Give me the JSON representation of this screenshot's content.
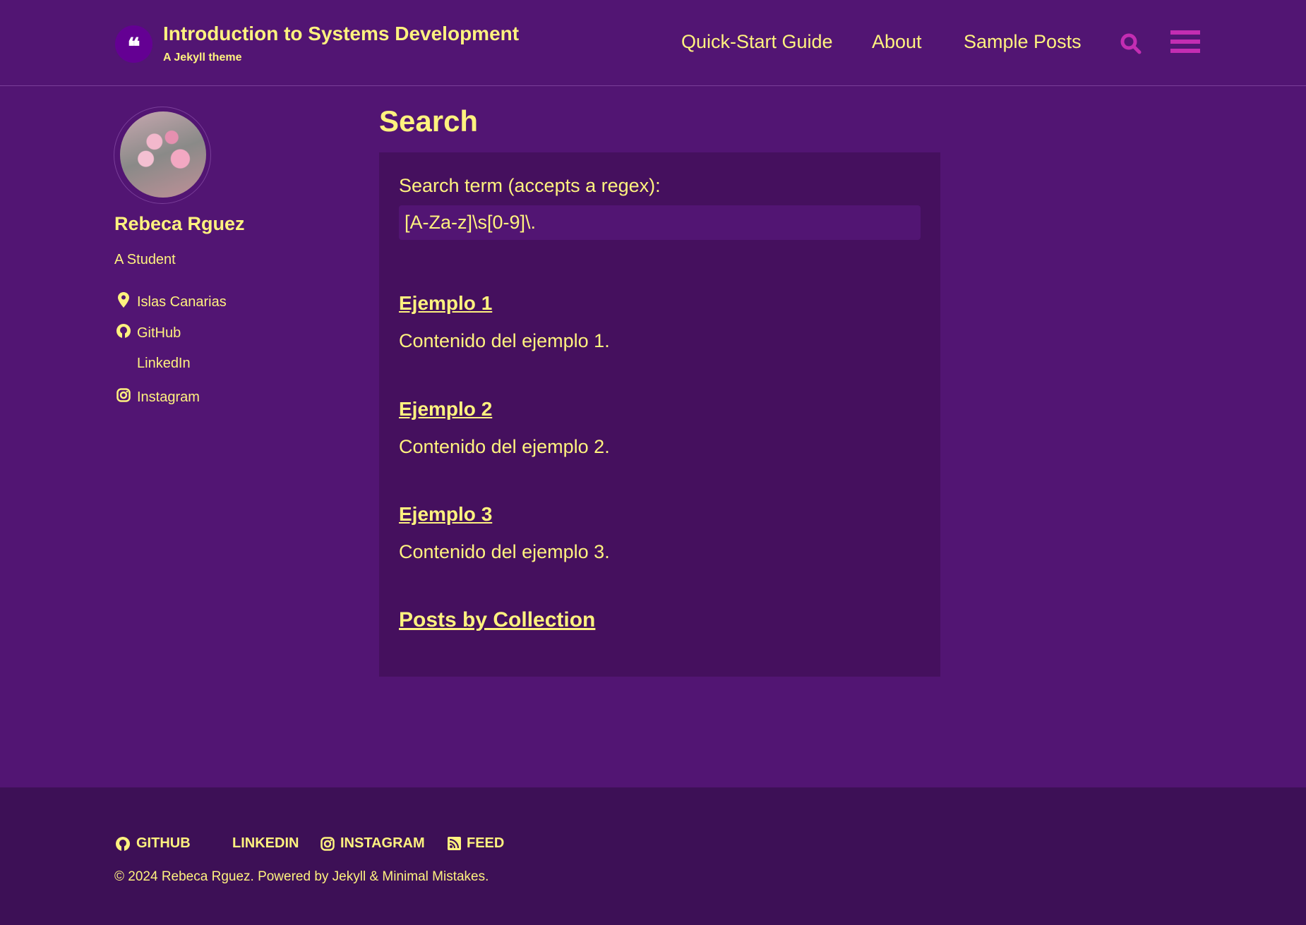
{
  "header": {
    "logo_glyph": "❝",
    "site_title": "Introduction to Systems Development",
    "site_subtitle": "A Jekyll theme",
    "nav": [
      {
        "label": "Quick-Start Guide"
      },
      {
        "label": "About"
      },
      {
        "label": "Sample Posts"
      }
    ],
    "icons": {
      "search": "search-icon",
      "menu": "hamburger-icon"
    },
    "icon_color": "#c32db2"
  },
  "sidebar": {
    "name": "Rebeca Rguez",
    "bio": "A Student",
    "items": [
      {
        "label": "Islas Canarias",
        "icon": "map-marker-icon"
      },
      {
        "label": "GitHub",
        "icon": "github-icon"
      },
      {
        "label": "LinkedIn",
        "icon": "linkedin-icon"
      },
      {
        "label": "Instagram",
        "icon": "instagram-icon"
      }
    ]
  },
  "main": {
    "title": "Search",
    "search_label": "Search term (accepts a regex):",
    "search_value": "[A-Za-z]\\s[0-9]\\.",
    "results": [
      {
        "title": "Ejemplo 1",
        "body": "Contenido del ejemplo 1."
      },
      {
        "title": "Ejemplo 2",
        "body": "Contenido del ejemplo 2."
      },
      {
        "title": "Ejemplo 3",
        "body": "Contenido del ejemplo 3."
      },
      {
        "title": "Posts by Collection"
      }
    ]
  },
  "footer": {
    "links": [
      {
        "label": "GITHUB",
        "icon": "github-icon"
      },
      {
        "label": "LINKEDIN",
        "icon": "linkedin-icon"
      },
      {
        "label": "INSTAGRAM",
        "icon": "instagram-icon"
      },
      {
        "label": "FEED",
        "icon": "rss-icon"
      }
    ],
    "copyright": "© 2024 Rebeca Rguez. Powered by Jekyll & Minimal Mistakes."
  },
  "colors": {
    "background": "#521573",
    "panel": "#45105e",
    "footer": "#3d1056",
    "text": "#fff27f",
    "accent": "#c32db2"
  }
}
